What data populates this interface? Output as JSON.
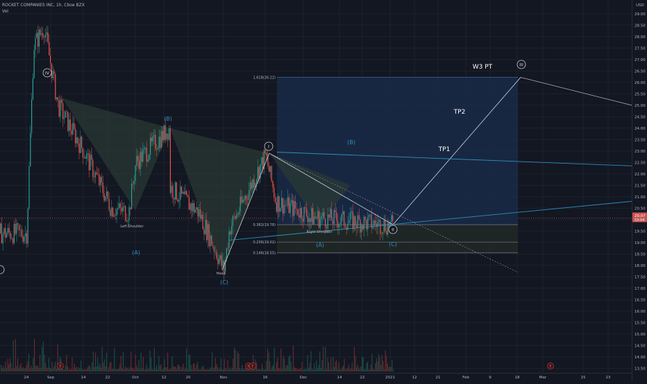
{
  "header": {
    "title": "ROCKET COMPANIES INC, 1h, Cboe BZX",
    "volume_label": "Vol"
  },
  "currency": "USD",
  "price_label": {
    "value": "20.07",
    "countdown": "53:04"
  },
  "colors": {
    "background": "#131722",
    "grid": "#1e222d",
    "text": "#b2b5be",
    "up": "#26a69a",
    "down": "#ef5350",
    "wave": "#2d8fbf",
    "fib_fill": "#1a2a47",
    "fib_line": "#787b86",
    "pattern_fill": "#2a3b33"
  },
  "chart_data": {
    "type": "candlestick",
    "y_range": [
      13.3,
      29.6
    ],
    "y_ticks": [
      "13.50",
      "14.00",
      "14.50",
      "15.00",
      "15.50",
      "16.00",
      "16.50",
      "17.00",
      "17.50",
      "18.00",
      "18.50",
      "19.00",
      "19.50",
      "20.00",
      "20.50",
      "21.00",
      "21.50",
      "22.00",
      "22.50",
      "23.00",
      "23.50",
      "24.00",
      "24.50",
      "25.00",
      "25.50",
      "26.00",
      "26.50",
      "27.00",
      "27.50",
      "28.00",
      "28.50",
      "29.00"
    ],
    "x_ticks": [
      "24",
      "Sep",
      "14",
      "22",
      "Oct",
      "12",
      "20",
      "Nov",
      "16",
      "Dec",
      "14",
      "22",
      "2021",
      "12",
      "21",
      "Feb",
      "9",
      "18",
      "Mar",
      "15",
      "23"
    ],
    "price_path": [
      [
        "24",
        19.4
      ],
      [
        "Sep",
        27.6
      ],
      [
        "Sep",
        28.4
      ],
      [
        "Sep",
        25.0
      ],
      [
        "14",
        23.0
      ],
      [
        "22",
        20.5
      ],
      [
        "22",
        20.3
      ],
      [
        "Oct",
        22.5
      ],
      [
        "12",
        24.0
      ],
      [
        "12",
        21.5
      ],
      [
        "20",
        20.3
      ],
      [
        "Nov",
        17.8
      ],
      [
        "Nov",
        19.6
      ],
      [
        "16",
        22.8
      ],
      [
        "16",
        20.8
      ],
      [
        "Dec",
        20.2
      ],
      [
        "Dec",
        19.8
      ],
      [
        "14",
        21.5
      ],
      [
        "14",
        22.8
      ],
      [
        "22",
        21.0
      ],
      [
        "2021",
        19.75
      ]
    ],
    "fib_levels": [
      {
        "label": "1.618(26.22)",
        "value": 26.22
      },
      {
        "label": "0.382(19.78)",
        "value": 19.78
      },
      {
        "label": "0.236(19.02)",
        "value": 19.02
      },
      {
        "label": "0.146(18.55)",
        "value": 18.55
      }
    ],
    "wave_labels": [
      "IV",
      "I",
      "II",
      "III",
      "(A)",
      "(B)",
      "(C)"
    ],
    "annotations": [
      "Left Shoulder",
      "Head",
      "Right Shoulder",
      "TP1",
      "TP2",
      "W3 PT"
    ],
    "event_markers": [
      "E",
      "E",
      "E",
      "E"
    ]
  }
}
